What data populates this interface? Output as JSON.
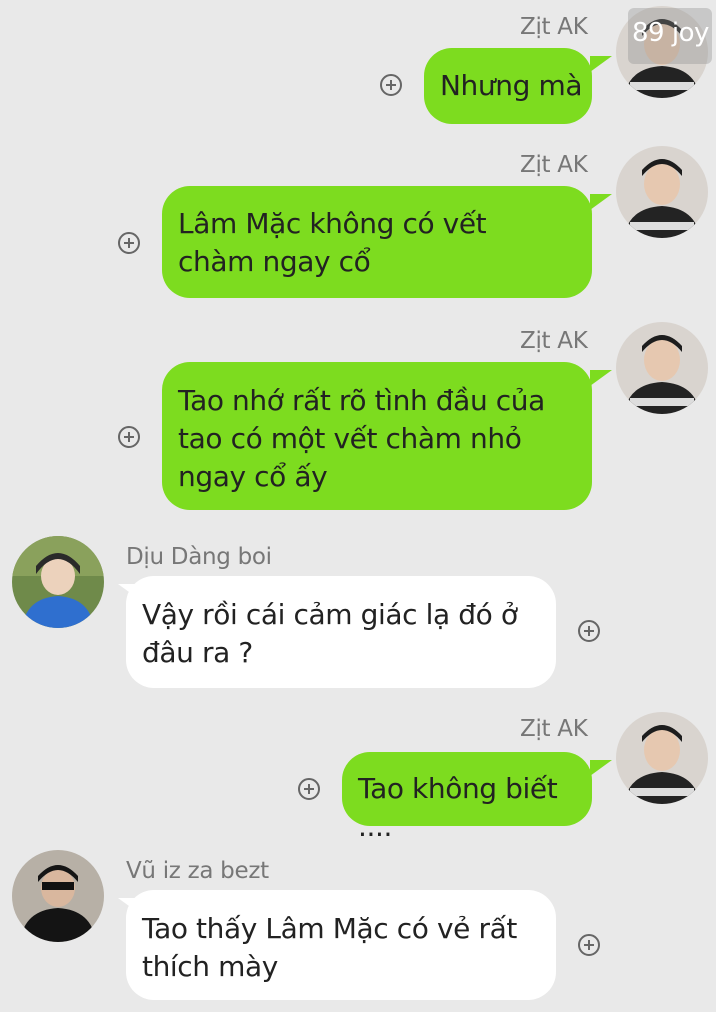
{
  "watermark": "89 joy",
  "messages": [
    {
      "sender": "Zịt AK",
      "text": "Nhưng mà",
      "side": "right"
    },
    {
      "sender": "Zịt AK",
      "text": "Lâm Mặc không có vết chàm ngay cổ",
      "side": "right"
    },
    {
      "sender": "Zịt AK",
      "text": "Tao nhớ rất rõ tình đầu của tao có một vết chàm nhỏ ngay cổ ấy",
      "side": "right"
    },
    {
      "sender": "Dịu Dàng boi",
      "text": "Vậy rồi cái cảm giác lạ đó ở đâu ra ?",
      "side": "left"
    },
    {
      "sender": "Zịt AK",
      "text": "Tao không biết ....",
      "side": "right"
    },
    {
      "sender": "Vũ iz za bezt",
      "text": "Tao thấy Lâm Mặc có vẻ rất thích mày",
      "side": "left"
    }
  ],
  "colors": {
    "outgoing": "#7ddc1f",
    "incoming": "#ffffff",
    "background": "#e9e9e9"
  },
  "icons": [
    "plus-circle-icon",
    "avatar-image"
  ]
}
